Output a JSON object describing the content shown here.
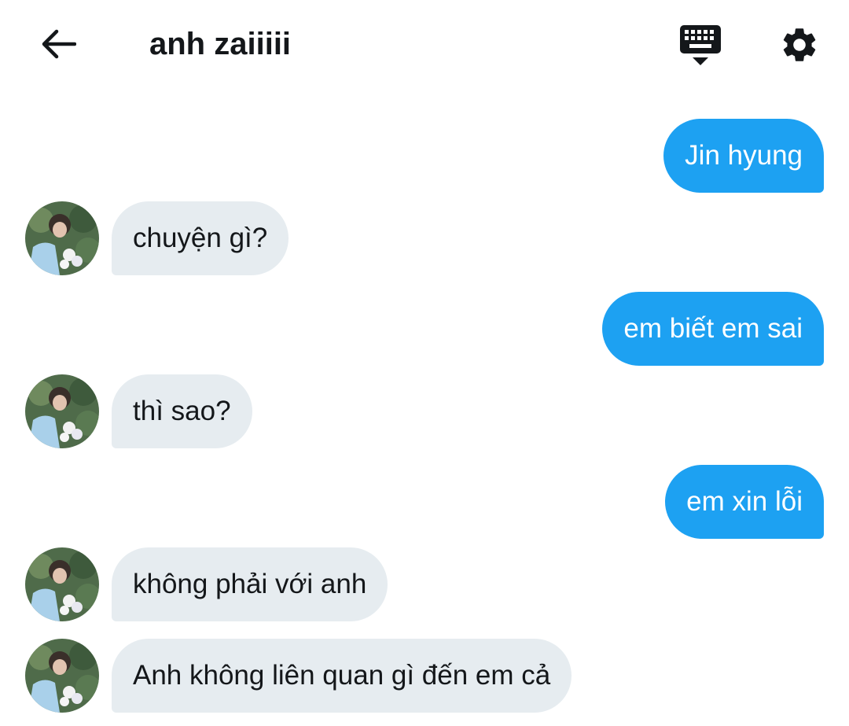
{
  "header": {
    "title": "anh zaiiiii",
    "back_icon": "arrow-left-icon",
    "keyboard_icon": "keyboard-icon",
    "settings_icon": "gear-icon"
  },
  "colors": {
    "outgoing_bubble": "#1da1f2",
    "incoming_bubble": "#e6ecf0"
  },
  "messages": [
    {
      "sender": "me",
      "text": "Jin hyung"
    },
    {
      "sender": "other",
      "text": "chuyện gì?"
    },
    {
      "sender": "me",
      "text": "em biết em sai"
    },
    {
      "sender": "other",
      "text": "thì sao?"
    },
    {
      "sender": "me",
      "text": "em xin lỗi"
    },
    {
      "sender": "other",
      "text": "không phải với anh"
    },
    {
      "sender": "other",
      "text": "Anh không liên quan gì đến em cả"
    }
  ]
}
